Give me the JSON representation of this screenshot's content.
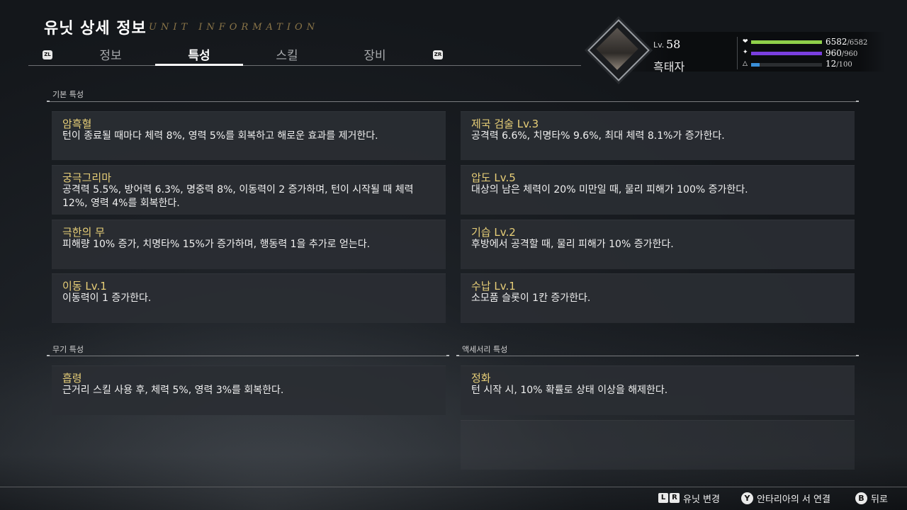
{
  "header": {
    "title": "유닛 상세 정보",
    "subtitle": "UNIT INFORMATION",
    "tabs": [
      {
        "label": "정보"
      },
      {
        "label": "특성"
      },
      {
        "label": "스킬"
      },
      {
        "label": "장비"
      }
    ],
    "active_tab": "특성",
    "left_button": "ZL",
    "right_button": "ZR"
  },
  "unit": {
    "lv_label": "Lv.",
    "level": "58",
    "name": "흑태자",
    "hp": {
      "icon": "heart-icon",
      "current": "6582",
      "max": "/6582",
      "fill": 1.0,
      "color": "#8fd04a"
    },
    "mp": {
      "icon": "spark-icon",
      "current": "960",
      "max": "/960",
      "fill": 1.0,
      "color": "#7a3fe0"
    },
    "ap": {
      "icon": "triangle-icon",
      "current": "12",
      "max": "/100",
      "fill": 0.12,
      "color": "#3a8fd8"
    }
  },
  "sections": {
    "basic": {
      "label": "기본 특성",
      "cards": [
        {
          "title": "암흑혈",
          "desc": "턴이 종료될 때마다 체력 8%, 영력 5%를 회복하고 해로운 효과를 제거한다."
        },
        {
          "title": "제국 검술 Lv.3",
          "desc": "공격력 6.6%, 치명타% 9.6%, 최대 체력 8.1%가 증가한다."
        },
        {
          "title": "궁극그리마",
          "desc": "공격력 5.5%, 방어력 6.3%,  명중력 8%, 이동력이 2 증가하며, 턴이 시작될 때 체력 12%, 영력 4%를 회복한다."
        },
        {
          "title": "압도 Lv.5",
          "desc": "대상의 남은 체력이 20% 미만일 때, 물리 피해가 100% 증가한다."
        },
        {
          "title": "극한의 무",
          "desc": "피해량 10% 증가, 치명타% 15%가 증가하며, 행동력 1을 추가로 얻는다."
        },
        {
          "title": "기습 Lv.2",
          "desc": "후방에서 공격할 때, 물리 피해가 10% 증가한다."
        },
        {
          "title": "이동 Lv.1",
          "desc": "이동력이 1 증가한다."
        },
        {
          "title": "수납 Lv.1",
          "desc": "소모품 슬롯이 1칸 증가한다."
        }
      ]
    },
    "weapon": {
      "label": "무기 특성",
      "cards": [
        {
          "title": "흡령",
          "desc": "근거리 스킬 사용 후, 체력 5%, 영력 3%를 회복한다."
        }
      ]
    },
    "accessory": {
      "label": "액세서리 특성",
      "cards": [
        {
          "title": "정화",
          "desc": "턴 시작 시, 10% 확률로 상태 이상을 해제한다."
        }
      ]
    }
  },
  "footer": {
    "change_unit": {
      "keys": [
        "L",
        "R"
      ],
      "label": "유닛 변경"
    },
    "link": {
      "key": "Y",
      "label": "안타리아의 서 연결"
    },
    "back": {
      "key": "B",
      "label": "뒤로"
    }
  }
}
